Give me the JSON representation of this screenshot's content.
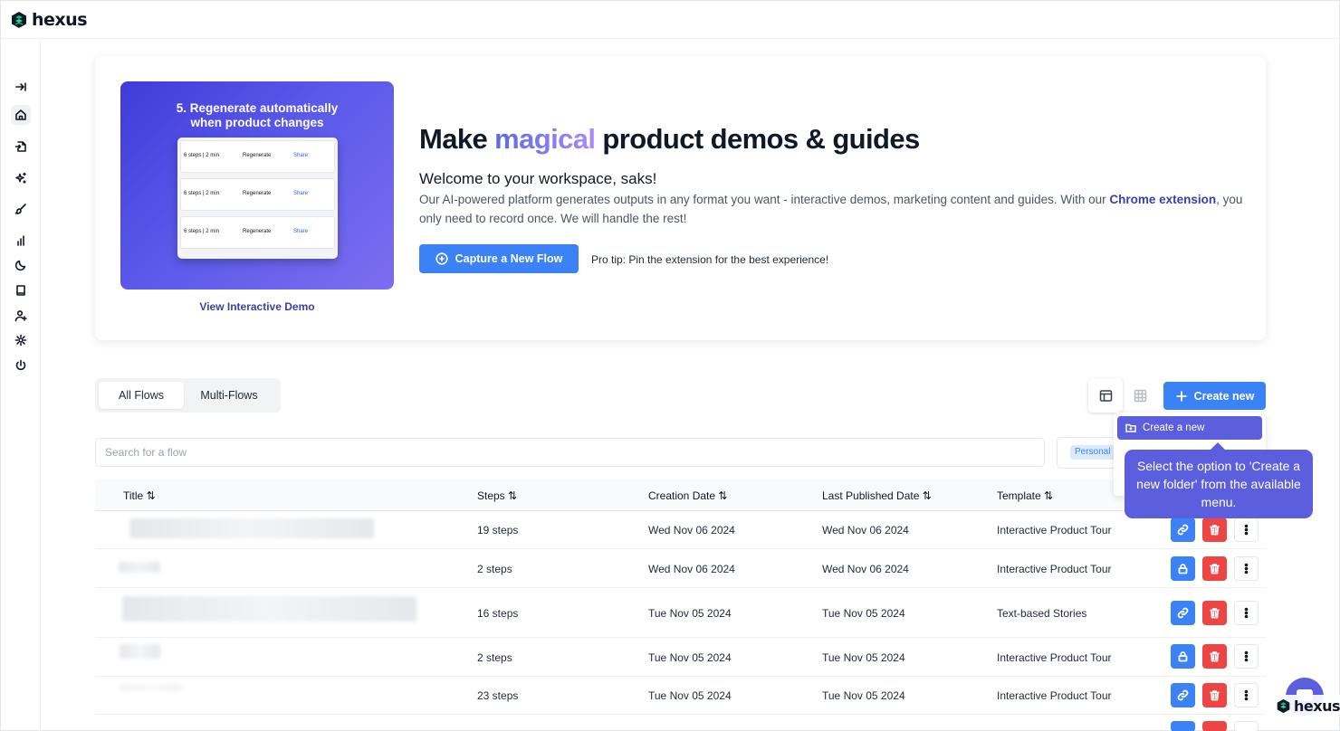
{
  "app": {
    "name": "hexus"
  },
  "colors": {
    "primary": "#3b82f6",
    "danger": "#ef4444",
    "accent": "#5b5fdd",
    "brand_green": "#10b981"
  },
  "sidebar": {
    "items": [
      {
        "name": "collapse",
        "icon": "arrow-right-bar-icon"
      },
      {
        "name": "home",
        "icon": "home-icon",
        "active": true
      },
      {
        "name": "import",
        "icon": "file-import-icon"
      },
      {
        "name": "ai",
        "icon": "sparkles-icon"
      },
      {
        "name": "brush",
        "icon": "brush-icon"
      },
      {
        "name": "analytics",
        "icon": "bar-chart-icon"
      },
      {
        "name": "theme",
        "icon": "moon-icon"
      },
      {
        "name": "docs",
        "icon": "book-icon"
      },
      {
        "name": "invite",
        "icon": "user-plus-icon"
      },
      {
        "name": "settings",
        "icon": "gear-icon"
      },
      {
        "name": "logout",
        "icon": "power-icon"
      }
    ]
  },
  "hero": {
    "thumbnail": {
      "title_line1": "5. Regenerate automatically",
      "title_line2": "when product changes",
      "rows": [
        {
          "steps": "6 steps | 2 min",
          "regenerate": "Regenerate",
          "share": "Share"
        },
        {
          "steps": "6 steps | 2 min",
          "regenerate": "Regenerate",
          "share": "Share"
        },
        {
          "steps": "6 steps | 2 min",
          "regenerate": "Regenerate",
          "share": "Share"
        }
      ]
    },
    "view_demo": "View Interactive Demo",
    "title_pre": "Make ",
    "title_highlight": "magical",
    "title_post": " product demos & guides",
    "welcome": "Welcome to your workspace, saks!",
    "desc_pre": "Our AI-powered platform generates outputs in any format you want - interactive demos, marketing content and guides. With our ",
    "desc_link": "Chrome extension",
    "desc_post": ", you only need to record once. We will handle the rest!",
    "capture_label": "Capture a New Flow",
    "pro_tip": "Pro tip: Pin the extension for the best experience!"
  },
  "tabs": [
    {
      "label": "All Flows",
      "active": true
    },
    {
      "label": "Multi-Flows",
      "active": false
    }
  ],
  "toolbar": {
    "create_label": "Create new"
  },
  "search": {
    "placeholder": "Search for a flow"
  },
  "filter": {
    "badge": "Personal"
  },
  "dropdown": {
    "item_label": "Create a new"
  },
  "tooltip": {
    "text": "Select the option to 'Create a new folder' from the available menu."
  },
  "table": {
    "headers": [
      "Title",
      "Steps",
      "Creation Date",
      "Last Published Date",
      "Template"
    ],
    "rows": [
      {
        "steps": "19 steps",
        "created": "Wed Nov 06 2024",
        "published": "Wed Nov 06 2024",
        "template": "Interactive Product Tour",
        "first_action": "link-icon"
      },
      {
        "steps": "2 steps",
        "created": "Wed Nov 06 2024",
        "published": "Wed Nov 06 2024",
        "template": "Interactive Product Tour",
        "first_action": "lock-icon"
      },
      {
        "steps": "16 steps",
        "created": "Tue Nov 05 2024",
        "published": "Tue Nov 05 2024",
        "template": "Text-based Stories",
        "first_action": "link-icon"
      },
      {
        "steps": "2 steps",
        "created": "Tue Nov 05 2024",
        "published": "Tue Nov 05 2024",
        "template": "Interactive Product Tour",
        "first_action": "lock-icon"
      },
      {
        "steps": "23 steps",
        "created": "Tue Nov 05 2024",
        "published": "Tue Nov 05 2024",
        "template": "Interactive Product Tour",
        "first_action": "link-icon"
      }
    ]
  }
}
